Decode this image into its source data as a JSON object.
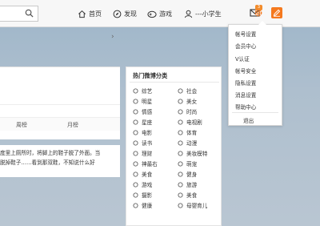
{
  "topbar": {
    "nav": [
      {
        "label": "首页",
        "icon": "home-icon"
      },
      {
        "label": "发现",
        "icon": "compass-icon"
      },
      {
        "label": "游戏",
        "icon": "gamepad-icon"
      },
      {
        "label": "---小学生",
        "icon": "user-icon"
      }
    ],
    "mail_badge": "3"
  },
  "left_card": {
    "tabs": [
      "周榜",
      "月榜"
    ]
  },
  "post": {
    "line1": "度里上厕所时，将脚上的鞋子脱了外面。当",
    "line2": "脱掉鞋子……看到那双鞋，不知说什么好"
  },
  "categories": {
    "title": "热门微博分类",
    "items": [
      {
        "label": "综艺",
        "icon": "variety-icon"
      },
      {
        "label": "社会",
        "icon": "society-icon"
      },
      {
        "label": "明星",
        "icon": "star-icon"
      },
      {
        "label": "美女",
        "icon": "beauty-icon"
      },
      {
        "label": "情感",
        "icon": "heart-icon"
      },
      {
        "label": "时尚",
        "icon": "fashion-icon"
      },
      {
        "label": "星座",
        "icon": "zodiac-icon"
      },
      {
        "label": "电视剧",
        "icon": "tv-icon"
      },
      {
        "label": "电影",
        "icon": "movie-icon"
      },
      {
        "label": "体育",
        "icon": "sports-icon"
      },
      {
        "label": "读书",
        "icon": "book-icon"
      },
      {
        "label": "动漫",
        "icon": "anime-icon"
      },
      {
        "label": "理财",
        "icon": "finance-icon"
      },
      {
        "label": "美妆模特",
        "icon": "makeup-icon"
      },
      {
        "label": "神最右",
        "icon": "funny-icon"
      },
      {
        "label": "萌宠",
        "icon": "pet-icon"
      },
      {
        "label": "美食",
        "icon": "food-icon"
      },
      {
        "label": "健身",
        "icon": "fitness-icon"
      },
      {
        "label": "游戏",
        "icon": "game-icon"
      },
      {
        "label": "旅游",
        "icon": "travel-icon"
      },
      {
        "label": "摄影",
        "icon": "camera-icon"
      },
      {
        "label": "美食",
        "icon": "cooking-icon"
      },
      {
        "label": "健康",
        "icon": "health-icon"
      },
      {
        "label": "母婴育儿",
        "icon": "baby-icon"
      }
    ]
  },
  "menu": {
    "items": [
      "帐号设置",
      "会员中心",
      "V认证",
      "帐号安全",
      "隐私设置",
      "消息设置",
      "帮助中心"
    ],
    "logout": "退出"
  },
  "colors": {
    "accent": "#f5791e",
    "badge": "#f28c2c"
  }
}
